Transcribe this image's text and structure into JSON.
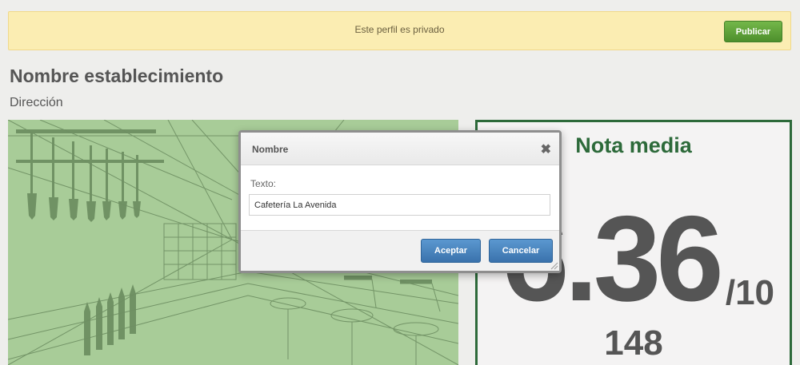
{
  "banner": {
    "message": "Este perfil es privado",
    "publish_label": "Publicar"
  },
  "establishment": {
    "name": "Nombre establecimiento",
    "address": "Dirección"
  },
  "rating": {
    "title": "Nota media",
    "value": "6.36",
    "max": "/10",
    "count": "148"
  },
  "dialog": {
    "title": "Nombre",
    "close_icon": "close-icon",
    "field_label": "Texto:",
    "field_value": "Cafetería La Avenida",
    "accept_label": "Aceptar",
    "cancel_label": "Cancelar"
  },
  "colors": {
    "banner_bg": "#fbedb2",
    "publish_green": "#5ea33a",
    "brand_green": "#2d6a3a",
    "hero_green": "#a8cc98",
    "button_blue": "#4a86c0"
  }
}
